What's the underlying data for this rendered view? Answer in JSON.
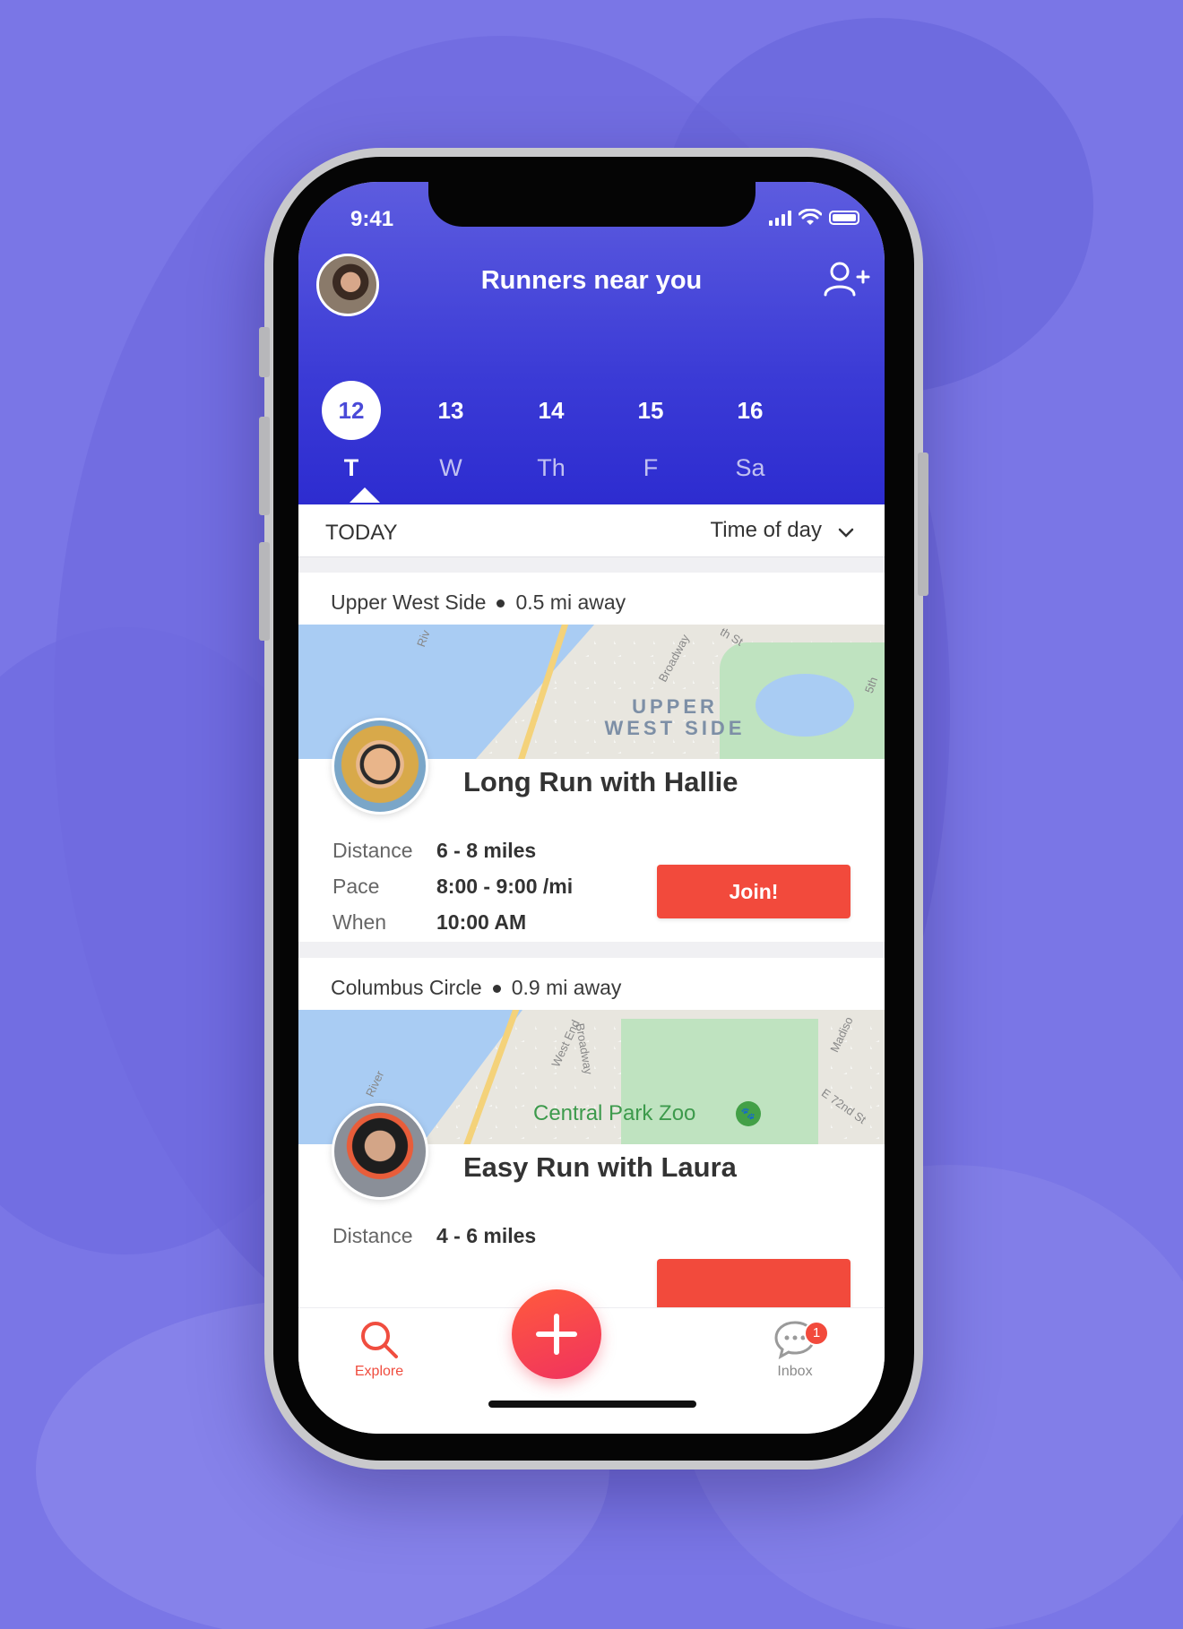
{
  "status": {
    "time": "9:41"
  },
  "header": {
    "title": "Runners near you"
  },
  "days": [
    {
      "num": "12",
      "weekday": "T",
      "selected": true
    },
    {
      "num": "13",
      "weekday": "W",
      "selected": false
    },
    {
      "num": "14",
      "weekday": "Th",
      "selected": false
    },
    {
      "num": "15",
      "weekday": "F",
      "selected": false
    },
    {
      "num": "16",
      "weekday": "Sa",
      "selected": false
    }
  ],
  "filter": {
    "label": "TODAY",
    "sort": "Time of day"
  },
  "runs": [
    {
      "location": "Upper West Side",
      "distance_away": "0.5 mi away",
      "map_label_line1": "UPPER",
      "map_label_line2": "WEST SIDE",
      "map_streets": [
        "Broadway",
        "Riv",
        "th St",
        "5th"
      ],
      "title": "Long Run with Hallie",
      "labels": {
        "distance": "Distance",
        "pace": "Pace",
        "when": "When"
      },
      "distance": "6 - 8 miles",
      "pace": "8:00 - 9:00 /mi",
      "when": "10:00 AM",
      "join_label": "Join!"
    },
    {
      "location": "Columbus Circle",
      "distance_away": "0.9 mi away",
      "map_poi": "Central Park Zoo",
      "map_streets": [
        "West End",
        "Broadway",
        "Madiso",
        "E 72nd St",
        "River"
      ],
      "title": "Easy Run with Laura",
      "labels": {
        "distance": "Distance"
      },
      "distance": "4 - 6 miles"
    }
  ],
  "tabbar": {
    "explore": "Explore",
    "inbox": "Inbox",
    "inbox_badge": "1"
  },
  "colors": {
    "brand": "#3b3bd6",
    "accent": "#f24a3c",
    "background": "#7a76e6"
  }
}
